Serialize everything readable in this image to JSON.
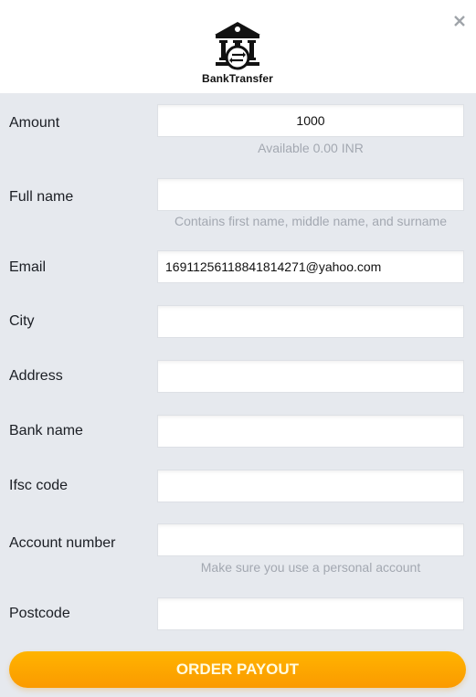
{
  "header": {
    "logo_text": "BankTransfer",
    "logo_icon": "bank-transfer-icon",
    "close_icon": "close-icon"
  },
  "fields": {
    "amount": {
      "label": "Amount",
      "value": "1000",
      "hint": "Available 0.00 INR"
    },
    "full_name": {
      "label": "Full name",
      "value": "",
      "hint": "Contains first name, middle name, and surname"
    },
    "email": {
      "label": "Email",
      "value": "16911256118841814271@yahoo.com"
    },
    "city": {
      "label": "City",
      "value": ""
    },
    "address": {
      "label": "Address",
      "value": ""
    },
    "bank_name": {
      "label": "Bank name",
      "value": ""
    },
    "ifsc_code": {
      "label": "Ifsc code",
      "value": ""
    },
    "account_number": {
      "label": "Account number",
      "value": "",
      "hint": "Make sure you use a personal account"
    },
    "postcode": {
      "label": "Postcode",
      "value": ""
    }
  },
  "submit": {
    "label": "ORDER PAYOUT"
  },
  "colors": {
    "accent": "#ffa800",
    "background": "#e6e9ee",
    "hint": "#a3a8b1"
  }
}
